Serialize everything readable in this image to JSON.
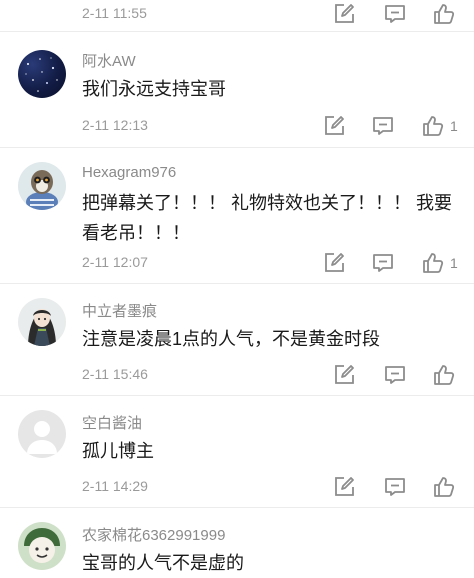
{
  "comments": [
    {
      "time": "2-11 11:55",
      "like_count": ""
    },
    {
      "username": "阿水AW",
      "text": "我们永远支持宝哥",
      "time": "2-11 12:13",
      "like_count": "1"
    },
    {
      "username": "Hexagram976",
      "text": "把弹幕关了！！！ 礼物特效也关了！！！ 我要看老吊！！！",
      "time": "2-11 12:07",
      "like_count": "1"
    },
    {
      "username": "中立者墨痕",
      "text": "注意是凌晨1点的人气，不是黄金时段",
      "time": "2-11 15:46",
      "like_count": ""
    },
    {
      "username": "空白酱油",
      "text": "孤儿博主",
      "time": "2-11 14:29",
      "like_count": ""
    },
    {
      "username": "农家棉花6362991999",
      "text": "宝哥的人气不是虚的"
    }
  ],
  "icons": {
    "edit": "edit-icon",
    "reply": "comment-reply-icon",
    "like": "thumbs-up-icon"
  },
  "colors": {
    "text": "#1a1a1a",
    "username": "#8a8a8a",
    "timestamp": "#9a9a9a",
    "icon": "#8c8c8c"
  }
}
